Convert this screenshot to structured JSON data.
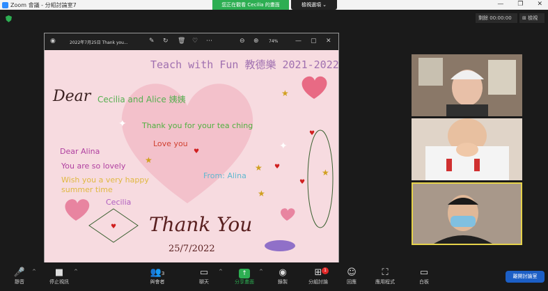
{
  "window": {
    "title": "Zoom 會議 - 分組討論室7",
    "share_banner": "您正在觀看 Cecilia 的畫面",
    "view_options": "檢視選項 ⌄",
    "controls": [
      "—",
      "❐",
      "✕"
    ]
  },
  "top_right": {
    "record_label": "剩餘",
    "timer": "00:00:00",
    "gallery_label": "⊞ 檢視"
  },
  "viewer": {
    "filename": "2022年7月25日 Thank you...",
    "zoom_level": "74%"
  },
  "card": {
    "title": "Teach with Fun 教德樂 2021-2022",
    "dear": "Dear",
    "names": "Cecilia and Alice 姨姨",
    "thanks": "Thank you for your tea ching",
    "love": "Love you",
    "dear_alina": "Dear Alina",
    "lovely": "You are so lovely",
    "wish_line1": "Wish you a very happy",
    "wish_line2": "summer time",
    "from": "From:  Alina",
    "signature": "Cecilia",
    "thank_you": "Thank You",
    "date": "25/7/2022"
  },
  "toolbar": {
    "mute": "靜音",
    "stop_video": "停止視訊",
    "participants": "與會者",
    "participants_count": "3",
    "chat": "聊天",
    "share_screen": "分享畫面",
    "record": "錄製",
    "breakout": "分組討論",
    "breakout_badge": "1",
    "reactions": "回應",
    "apps": "應用程式",
    "whiteboard": "白板",
    "leave": "離開討論室"
  },
  "colors": {
    "share_green": "#2dae52",
    "leave_blue": "#1c5fc6",
    "active_speaker": "#e6d34b",
    "card_bg": "#f7dbe0"
  }
}
